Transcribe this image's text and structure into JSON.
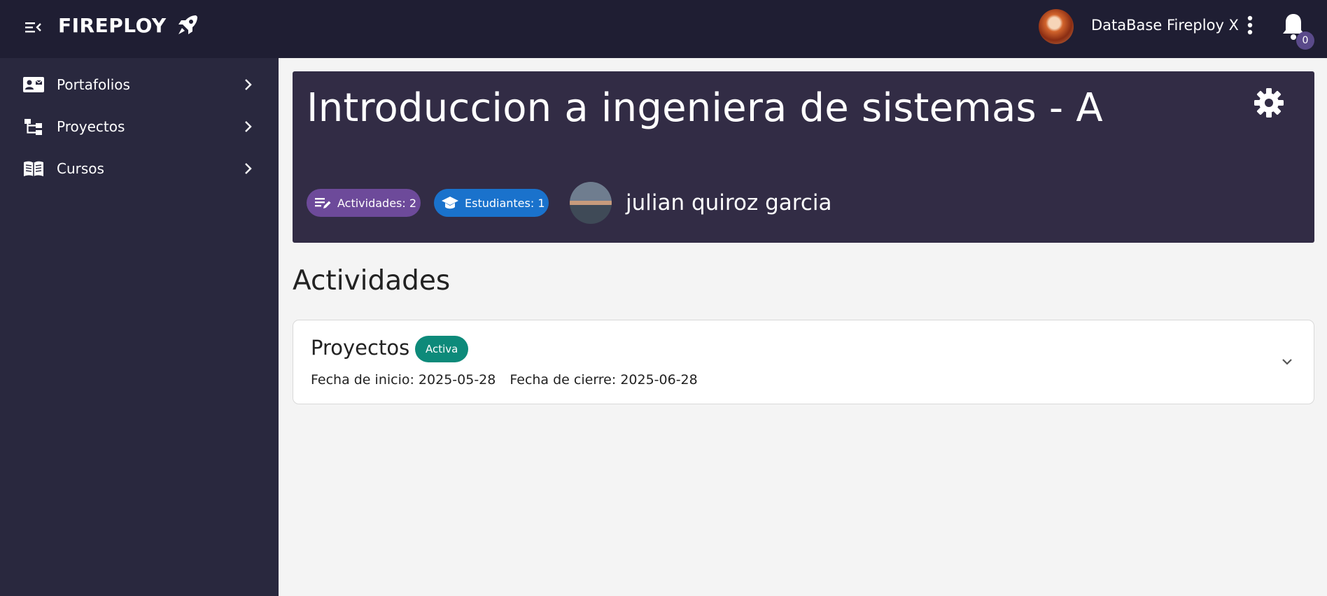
{
  "header": {
    "brand": "FIREPLOY",
    "user_name": "DataBase Fireploy X",
    "notification_count": "0"
  },
  "sidebar": {
    "items": [
      {
        "label": "Portafolios",
        "icon": "portfolio-card-icon"
      },
      {
        "label": "Proyectos",
        "icon": "project-tree-icon"
      },
      {
        "label": "Cursos",
        "icon": "book-icon"
      }
    ]
  },
  "course": {
    "title": "Introduccion a ingeniera de sistemas - A",
    "activities_chip": "Actividades: 2",
    "students_chip": "Estudiantes: 1",
    "teacher_name": "julian quiroz garcia"
  },
  "activities": {
    "section_title": "Actividades",
    "items": [
      {
        "title": "Proyectos",
        "status": "Activa",
        "start_date": "Fecha de inicio: 2025-05-28",
        "end_date": "Fecha de cierre: 2025-06-28"
      }
    ]
  },
  "colors": {
    "topbar": "#1f1e33",
    "sidebar": "#29283e",
    "banner": "#322c45",
    "chip_activities": "#6d4a9a",
    "chip_students": "#1a72cc",
    "status_active": "#0d8a7a"
  }
}
